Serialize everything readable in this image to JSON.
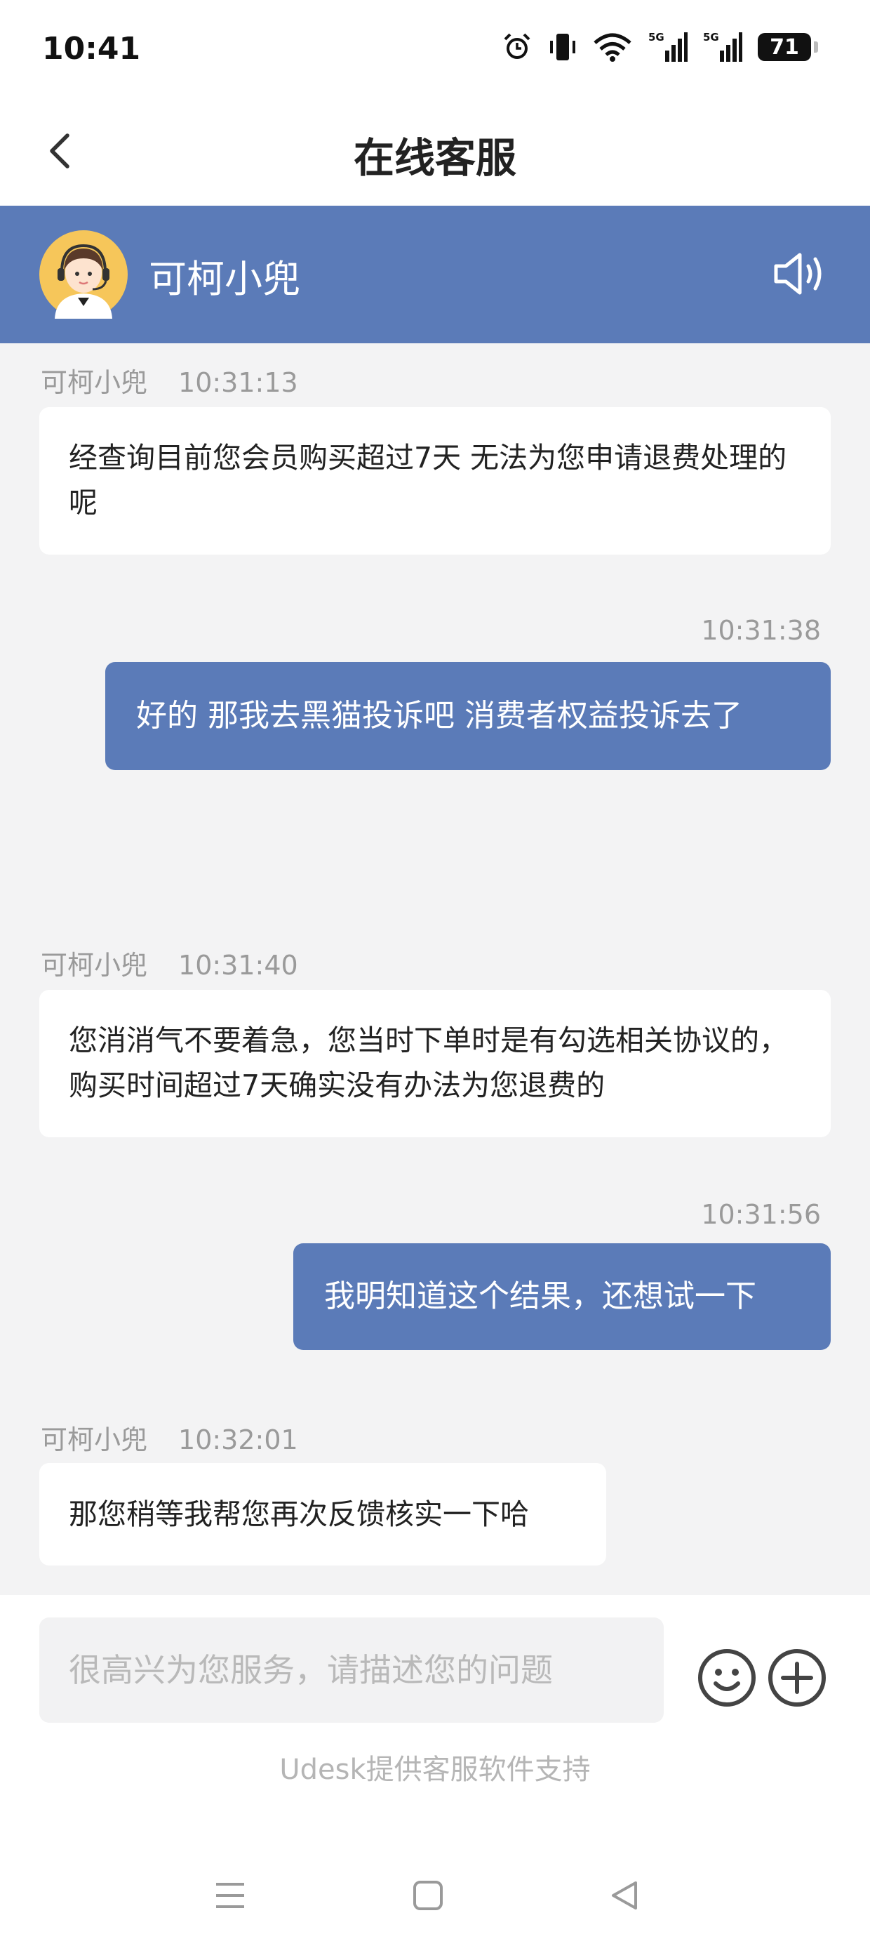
{
  "status_bar": {
    "time": "10:41",
    "battery": "71",
    "network": "5G"
  },
  "nav": {
    "title": "在线客服"
  },
  "agent": {
    "name": "可柯小兜"
  },
  "messages": [
    {
      "from": "agent",
      "sender": "可柯小兜",
      "time": "10:31:13",
      "text": "经查询目前您会员购买超过7天 无法为您申请退费处理的呢"
    },
    {
      "from": "user",
      "time": "10:31:38",
      "text": "好的 那我去黑猫投诉吧 消费者权益投诉去了"
    },
    {
      "from": "agent",
      "sender": "可柯小兜",
      "time": "10:31:40",
      "text": "您消消气不要着急，您当时下单时是有勾选相关协议的，购买时间超过7天确实没有办法为您退费的"
    },
    {
      "from": "user",
      "time": "10:31:56",
      "text": "我明知道这个结果，还想试一下"
    },
    {
      "from": "agent",
      "sender": "可柯小兜",
      "time": "10:32:01",
      "text": "那您稍等我帮您再次反馈核实一下哈"
    }
  ],
  "input": {
    "value": "",
    "placeholder": "很高兴为您服务，请描述您的问题"
  },
  "footer": {
    "powered_by": "Udesk提供客服软件支持"
  },
  "colors": {
    "accent": "#5b7bb8",
    "background": "#f3f3f4",
    "bubble_in": "#ffffff",
    "meta_text": "#9a9a9a"
  },
  "icons": {
    "back": "chevron-left-icon",
    "speaker": "speaker-icon",
    "emoji": "smiley-icon",
    "plus": "plus-circle-icon",
    "system_nav": [
      "menu-icon",
      "home-square-icon",
      "back-triangle-icon"
    ]
  }
}
